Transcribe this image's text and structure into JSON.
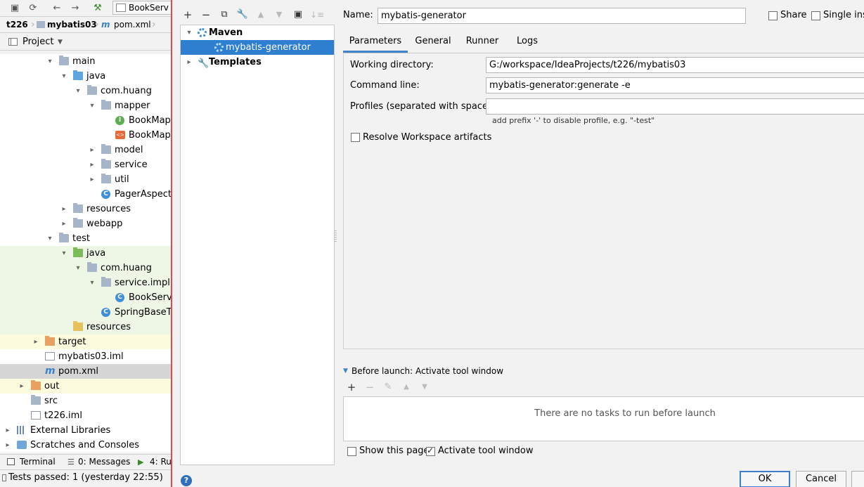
{
  "ide": {
    "toolbar_tab": "BookServ",
    "breadcrumb": [
      "t226",
      "mybatis03",
      "pom.xml"
    ],
    "project_label": "Project",
    "tree": [
      {
        "label": "main",
        "depth": 3,
        "arrow": "▾",
        "icon": "folder"
      },
      {
        "label": "java",
        "depth": 4,
        "arrow": "▾",
        "icon": "folder-blue"
      },
      {
        "label": "com.huang",
        "depth": 5,
        "arrow": "▾",
        "icon": "folder"
      },
      {
        "label": "mapper",
        "depth": 6,
        "arrow": "▾",
        "icon": "folder"
      },
      {
        "label": "BookMap",
        "depth": 7,
        "arrow": "",
        "icon": "interface"
      },
      {
        "label": "BookMap",
        "depth": 7,
        "arrow": "",
        "icon": "xml"
      },
      {
        "label": "model",
        "depth": 6,
        "arrow": "▸",
        "icon": "folder"
      },
      {
        "label": "service",
        "depth": 6,
        "arrow": "▸",
        "icon": "folder"
      },
      {
        "label": "util",
        "depth": 6,
        "arrow": "▸",
        "icon": "folder"
      },
      {
        "label": "PagerAspect",
        "depth": 6,
        "arrow": "",
        "icon": "class"
      },
      {
        "label": "resources",
        "depth": 4,
        "arrow": "▸",
        "icon": "folder"
      },
      {
        "label": "webapp",
        "depth": 4,
        "arrow": "▸",
        "icon": "folder"
      },
      {
        "label": "test",
        "depth": 3,
        "arrow": "▾",
        "icon": "folder"
      },
      {
        "label": "java",
        "depth": 4,
        "arrow": "▾",
        "icon": "folder-green",
        "bg": "green"
      },
      {
        "label": "com.huang",
        "depth": 5,
        "arrow": "▾",
        "icon": "folder",
        "bg": "green"
      },
      {
        "label": "service.impl",
        "depth": 6,
        "arrow": "▾",
        "icon": "folder",
        "bg": "green"
      },
      {
        "label": "BookServi",
        "depth": 7,
        "arrow": "",
        "icon": "class",
        "bg": "green"
      },
      {
        "label": "SpringBaseTe",
        "depth": 6,
        "arrow": "",
        "icon": "class",
        "bg": "green"
      },
      {
        "label": "resources",
        "depth": 4,
        "arrow": "",
        "icon": "folder-yellow",
        "bg": "green"
      },
      {
        "label": "target",
        "depth": 2,
        "arrow": "▸",
        "icon": "folder-orange",
        "bg": "yellow"
      },
      {
        "label": "mybatis03.iml",
        "depth": 2,
        "arrow": "",
        "icon": "file"
      },
      {
        "label": "pom.xml",
        "depth": 2,
        "arrow": "",
        "icon": "maven",
        "bg": "sel"
      },
      {
        "label": "out",
        "depth": 1,
        "arrow": "▸",
        "icon": "folder-orange",
        "bg": "yellow"
      },
      {
        "label": "src",
        "depth": 1,
        "arrow": "",
        "icon": "folder"
      },
      {
        "label": "t226.iml",
        "depth": 1,
        "arrow": "",
        "icon": "file"
      },
      {
        "label": "External Libraries",
        "depth": 0,
        "arrow": "▸",
        "icon": "library"
      },
      {
        "label": "Scratches and Consoles",
        "depth": 0,
        "arrow": "▸",
        "icon": "scratch"
      }
    ],
    "bottom_tabs": [
      "Terminal",
      "0: Messages",
      "4: Ru"
    ],
    "status": "Tests passed: 1 (yesterday 22:55)"
  },
  "dialog": {
    "config_tree": [
      {
        "label": "Maven",
        "bold": true,
        "arrow": "▾",
        "icon": "gear-icon",
        "depth": 0
      },
      {
        "label": "mybatis-generator",
        "bold": false,
        "arrow": "",
        "icon": "gear-icon",
        "depth": 1,
        "selected": true
      },
      {
        "label": "Templates",
        "bold": true,
        "arrow": "▸",
        "icon": "wrench-icon",
        "depth": 0
      }
    ],
    "name_label": "Name:",
    "name_value": "mybatis-generator",
    "share_label": "Share",
    "single_instance_label": "Single inst",
    "tabs": [
      "Parameters",
      "General",
      "Runner",
      "Logs"
    ],
    "working_directory_label": "Working directory:",
    "working_directory_value": "G:/workspace/IdeaProjects/t226/mybatis03",
    "command_line_label": "Command line:",
    "command_line_value": "mybatis-generator:generate -e",
    "profiles_label": "Profiles (separated with space):",
    "profiles_value": "",
    "profiles_hint": "add prefix '-' to disable profile, e.g. \"-test\"",
    "resolve_workspace_label": "Resolve Workspace artifacts",
    "before_launch_label": "Before launch: Activate tool window",
    "no_tasks_text": "There are no tasks to run before launch",
    "show_this_page_label": "Show this page",
    "activate_tool_window_label": "Activate tool window",
    "ok_label": "OK",
    "cancel_label": "Cancel",
    "help_glyph": "?"
  }
}
